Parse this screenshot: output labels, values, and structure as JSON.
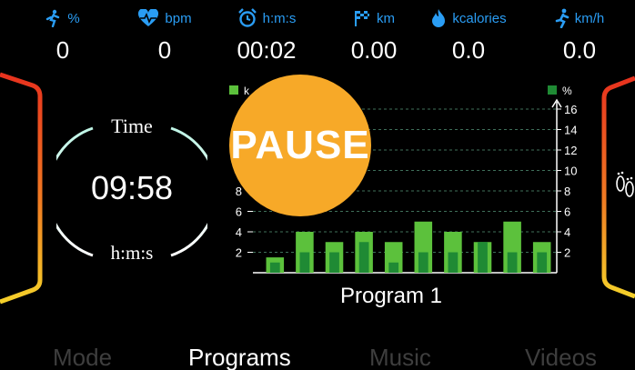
{
  "stats": [
    {
      "icon": "incline-icon",
      "unit": "%",
      "value": "0"
    },
    {
      "icon": "heart-rate-icon",
      "unit": "bpm",
      "value": "0"
    },
    {
      "icon": "alarm-clock-icon",
      "unit": "h:m:s",
      "value": "00:02"
    },
    {
      "icon": "checkered-flag-icon",
      "unit": "km",
      "value": "0.00"
    },
    {
      "icon": "flame-icon",
      "unit": "kcalories",
      "value": "0.0"
    },
    {
      "icon": "runner-icon",
      "unit": "km/h",
      "value": "0.0"
    }
  ],
  "timer": {
    "top_label": "Time",
    "value": "09:58",
    "bottom_label": "h:m:s"
  },
  "chart": {
    "legend_left": "k",
    "legend_right": "%",
    "program_name": "Program 1"
  },
  "chart_data": {
    "type": "bar",
    "left_axis_ticks": [
      "2",
      "4",
      "6",
      "8"
    ],
    "right_axis_ticks": [
      "2",
      "4",
      "6",
      "8",
      "10",
      "12",
      "14",
      "16"
    ],
    "ylim": [
      0,
      16
    ],
    "series": [
      {
        "values": [
          1.5,
          4,
          3,
          4,
          3,
          5,
          4,
          3,
          5,
          3
        ],
        "color": "#5cc13c"
      },
      {
        "values": [
          1,
          2,
          2,
          3,
          1,
          2,
          2,
          3,
          2,
          2
        ],
        "color": "#1f8a34"
      }
    ],
    "grid": true
  },
  "pause_label": "PAUSE",
  "tabs": [
    {
      "label": "Mode",
      "state": "dim"
    },
    {
      "label": "Programs",
      "state": "active"
    },
    {
      "label": "Music",
      "state": "dim"
    },
    {
      "label": "Videos",
      "state": "dim"
    }
  ],
  "colors": {
    "accent_blue": "#2a9df4",
    "pause_orange": "#f7a928",
    "bar_light": "#5cc13c",
    "bar_dark": "#1f8a34"
  }
}
